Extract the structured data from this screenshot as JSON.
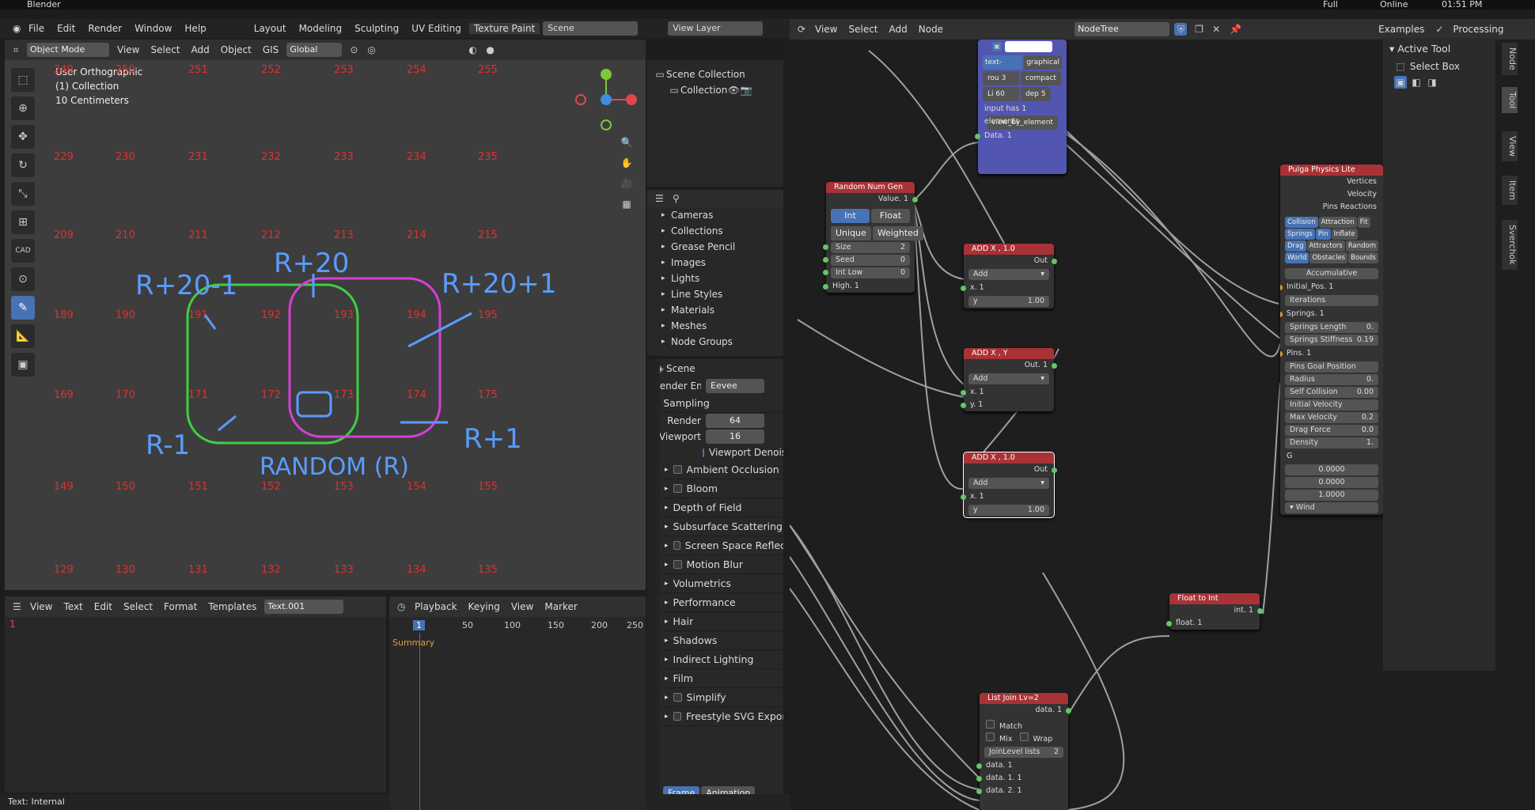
{
  "os_bar": {
    "app": "Blender",
    "battery": "Full",
    "network": "Online",
    "time": "01:51 PM"
  },
  "menu": [
    "File",
    "Edit",
    "Render",
    "Window",
    "Help"
  ],
  "workspaces": [
    "Layout",
    "Modeling",
    "Sculpting",
    "UV Editing",
    "Texture Paint"
  ],
  "scene_name": "Scene",
  "view_layer": "View Layer",
  "viewport": {
    "mode": "Object Mode",
    "menus": [
      "View",
      "Select",
      "Add",
      "Object",
      "GIS"
    ],
    "orientation": "Global",
    "info": [
      "User Orthographic",
      "(1) Collection",
      "10 Centimeters"
    ],
    "grid_numbers": [
      [
        "249",
        "250",
        "251",
        "252",
        "253",
        "254",
        "255"
      ],
      [
        "229",
        "230",
        "231",
        "232",
        "233",
        "234",
        "235"
      ],
      [
        "209",
        "210",
        "211",
        "212",
        "213",
        "214",
        "215"
      ],
      [
        "189",
        "190",
        "191",
        "192",
        "193",
        "194",
        "195"
      ],
      [
        "169",
        "170",
        "171",
        "172",
        "173",
        "174",
        "175"
      ],
      [
        "149",
        "150",
        "151",
        "152",
        "153",
        "154",
        "155"
      ],
      [
        "129",
        "130",
        "131",
        "132",
        "133",
        "134",
        "135"
      ]
    ],
    "annotations": {
      "tl": "R+20-1",
      "tc": "R+20",
      "tr": "R+20+1",
      "bl": "R-1",
      "br": "R+1",
      "bottom": "RANDOM (R)"
    }
  },
  "outliner": {
    "scene_collection": "Scene Collection",
    "collection": "Collection"
  },
  "data_api": [
    "Cameras",
    "Collections",
    "Grease Pencil",
    "Images",
    "Lights",
    "Line Styles",
    "Materials",
    "Meshes",
    "Node Groups"
  ],
  "props": {
    "title": "Scene",
    "render_engine_label": "Render Engine",
    "render_engine": "Eevee",
    "sampling": "Sampling",
    "render_label": "Render",
    "render_val": "64",
    "viewport_label": "Viewport",
    "viewport_val": "16",
    "viewport_denoise": "Viewport Denoising",
    "sections": [
      "Ambient Occlusion",
      "Bloom",
      "Depth of Field",
      "Subsurface Scattering",
      "Screen Space Reflections",
      "Motion Blur",
      "Volumetrics",
      "Performance",
      "Hair",
      "Shadows",
      "Indirect Lighting",
      "Film",
      "Simplify",
      "Freestyle SVG Export"
    ],
    "checkbox_sections": [
      "Ambient Occlusion",
      "Bloom",
      "Screen Space Reflections",
      "Motion Blur",
      "Simplify",
      "Freestyle SVG Export"
    ],
    "tabs": [
      "Frame",
      "Animation"
    ]
  },
  "text_editor": {
    "menus": [
      "View",
      "Text",
      "Edit",
      "Select",
      "Format",
      "Templates"
    ],
    "name": "Text.001",
    "line": "1",
    "status": "Text: Internal"
  },
  "timeline": {
    "menus": [
      "Playback",
      "Keying",
      "View",
      "Marker"
    ],
    "frame": "1",
    "ticks": [
      "50",
      "100",
      "150",
      "200",
      "250"
    ],
    "summary": "Summary"
  },
  "node_editor": {
    "menus": [
      "View",
      "Select",
      "Add",
      "Node"
    ],
    "tree": "NodeTree",
    "examples": "Examples",
    "processing": "Processing",
    "viewer_node": {
      "mode1": "text-based",
      "mode2": "graphical",
      "rou": "rou 3",
      "compact": "compact",
      "li": "Li 60",
      "dep": "dep 5",
      "info": "input has 1 elements",
      "view_btn": "view_by_element",
      "out": "Data. 1"
    },
    "random": {
      "title": "Random Num Gen",
      "out": "Value. 1",
      "int": "Int",
      "float": "Float",
      "unique": "Unique",
      "weighted": "Weighted",
      "size": "Size",
      "size_v": "2",
      "seed": "Seed",
      "seed_v": "0",
      "low": "Int Low",
      "low_v": "0",
      "high": "High. 1"
    },
    "add1": {
      "title": "ADD X , 1.0",
      "out": "Out",
      "op": "Add",
      "x": "x. 1",
      "y": "y",
      "yv": "1.00"
    },
    "addxy": {
      "title": "ADD X , Y",
      "out": "Out. 1",
      "op": "Add",
      "x": "x. 1",
      "y": "y. 1"
    },
    "add2": {
      "title": "ADD X , 1.0",
      "out": "Out",
      "op": "Add",
      "x": "x. 1",
      "y": "y",
      "yv": "1.00"
    },
    "f2i": {
      "title": "Float to Int",
      "out": "int. 1",
      "in": "float. 1"
    },
    "listjoin": {
      "title": "List Join Lv=2",
      "out": "data. 1",
      "match": "Match",
      "mix": "Mix",
      "wrap": "Wrap",
      "levels": "JoinLevel lists",
      "levels_v": "2",
      "in1": "data. 1",
      "in2": "data. 1. 1",
      "in3": "data. 2. 1"
    },
    "pulga": {
      "title": "Pulga Physics Lite",
      "outs": [
        "Vertices",
        "Velocity",
        "Pins Reactions"
      ],
      "tabs": [
        [
          "Collision",
          "Attraction",
          "Fit"
        ],
        [
          "Springs",
          "Pin",
          "Inflate"
        ],
        [
          "Drag",
          "Attractors",
          "Random"
        ],
        [
          "World",
          "Obstacles",
          "Bounds"
        ]
      ],
      "accum": "Accumulative",
      "inputs": [
        "Initial_Pos. 1",
        "Iterations",
        "Springs. 1",
        "Springs Length",
        "Springs Stiffness",
        "Pins. 1",
        "Pins Goal Position",
        "Radius",
        "Self Collision",
        "Initial Velocity",
        "Max Velocity",
        "Drag Force",
        "Density"
      ],
      "vals": {
        "Springs Length": "0.",
        "Springs Stiffness": "0.19",
        "Radius": "0.",
        "Self Collision": "0.00",
        "Max Velocity": "0.2",
        "Drag Force": "0.0",
        "Density": "1."
      },
      "g": "G",
      "gvals": [
        "0.0000",
        "0.0000",
        "1.0000"
      ],
      "wind": "Wind"
    }
  },
  "tool_panel": {
    "title": "Active Tool",
    "tool": "Select Box",
    "tabs": [
      "Node",
      "Tool",
      "View",
      "Item",
      "Sverchok"
    ]
  },
  "colors": {
    "accent": "#4772b3",
    "node_header": "#a83236",
    "socket": "#63c763",
    "grid_num": "#e03030",
    "ink_green": "#3fcf3f",
    "ink_magenta": "#d63fd6",
    "ink_blue": "#5a9cff"
  }
}
